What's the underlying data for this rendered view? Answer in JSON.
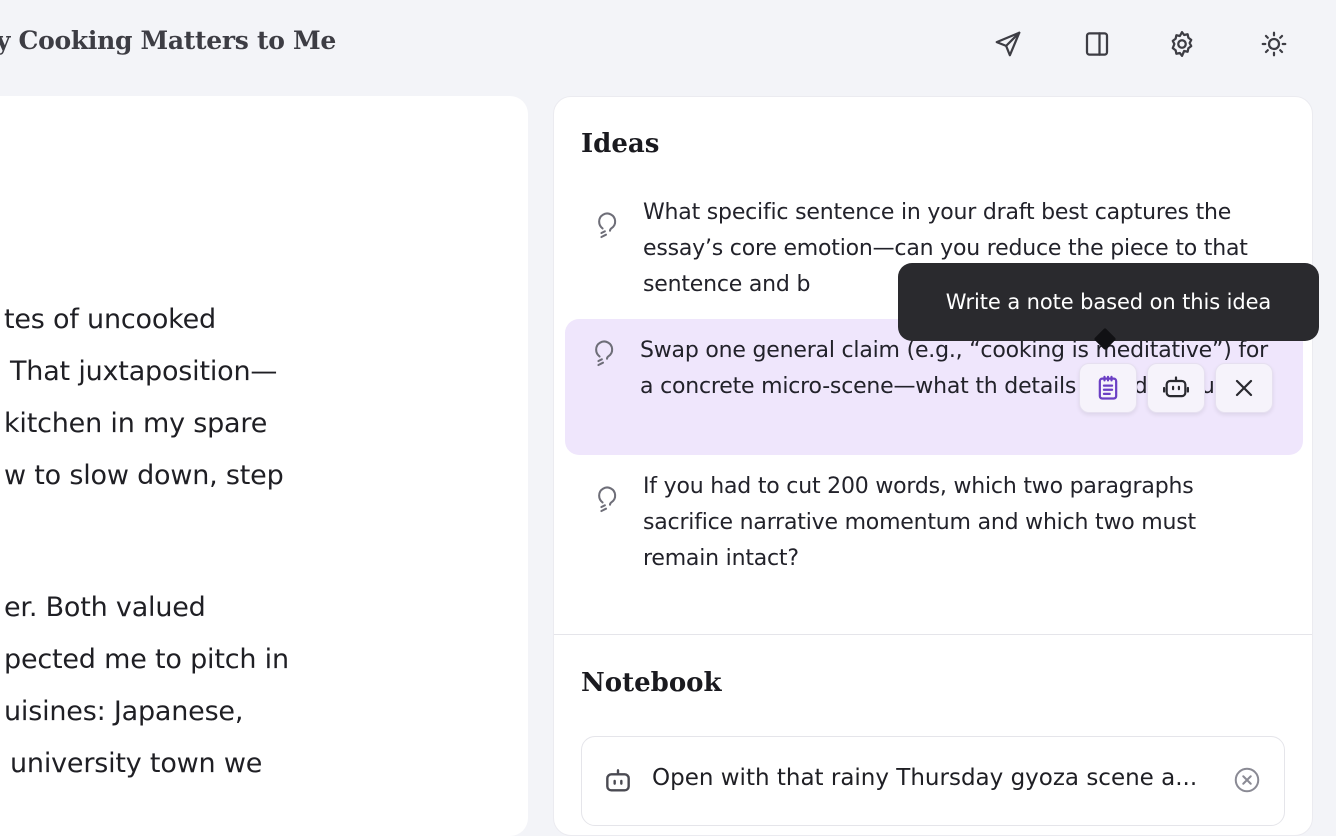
{
  "header": {
    "doc_title": "hy Cooking Matters to Me",
    "send_tooltip": "",
    "icons": [
      "send-icon",
      "sidebar-toggle-icon",
      "gear-icon",
      "sun-icon"
    ]
  },
  "editor": {
    "lines": [
      "tes of uncooked",
      "That juxtaposition—",
      "kitchen in my spare",
      "w to slow down, step",
      "er. Both valued",
      "pected me to pitch in",
      "uisines: Japanese,",
      "university town we"
    ]
  },
  "ideas": {
    "title": "Ideas",
    "items": [
      {
        "text": "What specific sentence in your draft best captures the essay’s core emotion—can you reduce the piece to that sentence and b"
      },
      {
        "text": "Swap one general claim (e.g., “cooking is meditative”) for a concrete micro-scene—what th details would you use?"
      },
      {
        "text": "If you had to cut 200 words, which two paragraphs sacrifice narrative momentum and which two must remain intact?"
      }
    ],
    "tooltip": "Write a note based on this idea"
  },
  "notebook": {
    "title": "Notebook",
    "notes": [
      {
        "text": "Open with that rainy Thursday gyoza scene a..."
      }
    ]
  },
  "colors": {
    "background": "#f3f4f8",
    "highlight": "#efe6fc",
    "accent": "#6b3fc4",
    "tooltip_bg": "#2a2a2e"
  }
}
